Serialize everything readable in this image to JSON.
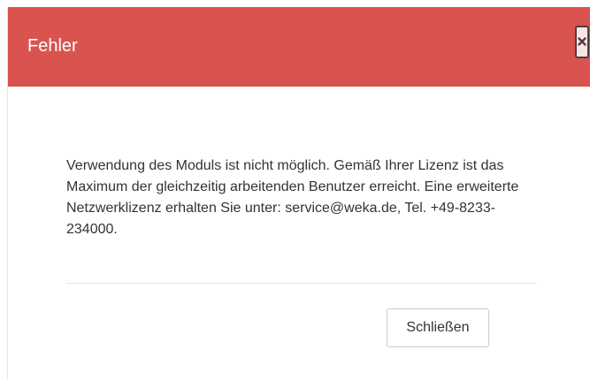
{
  "dialog": {
    "title": "Fehler",
    "close_icon": "close-icon",
    "message": "Verwendung des Moduls ist nicht möglich. Gemäß Ihrer Lizenz ist das Maximum der gleichzeitig arbeitenden Benutzer erreicht. Eine erweiterte Netzwerklizenz erhalten Sie unter: service@weka.de, Tel. +49-8233-234000.",
    "close_button_label": "Schließen"
  },
  "colors": {
    "header_background": "#d9534f",
    "header_text": "#ffffff",
    "body_text": "#333333"
  }
}
